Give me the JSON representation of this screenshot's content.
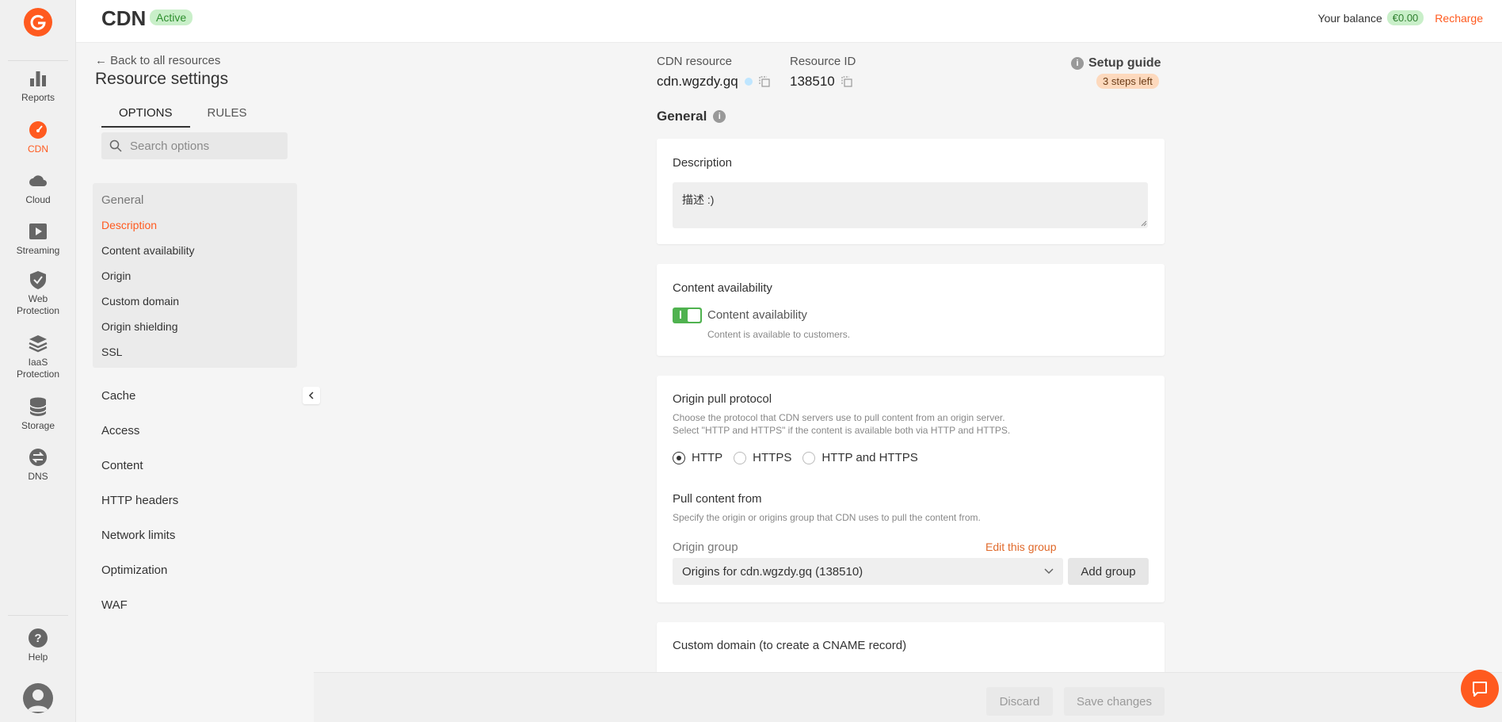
{
  "rail": {
    "items": [
      {
        "label": "Reports",
        "icon": "bar-chart-icon"
      },
      {
        "label": "CDN",
        "icon": "speedometer-icon"
      },
      {
        "label": "Cloud",
        "icon": "cloud-icon"
      },
      {
        "label": "Streaming",
        "icon": "play-icon"
      },
      {
        "label": "Web Protection",
        "icon": "shield-icon"
      },
      {
        "label": "IaaS Protection",
        "icon": "stack-icon"
      },
      {
        "label": "Storage",
        "icon": "database-icon"
      },
      {
        "label": "DNS",
        "icon": "dns-icon"
      }
    ],
    "help_label": "Help"
  },
  "header": {
    "title": "CDN",
    "status": "Active",
    "balance_label": "Your balance",
    "balance_amount": "€0.00",
    "recharge": "Recharge"
  },
  "settings": {
    "back": "← Back to all resources",
    "title": "Resource settings",
    "tabs": [
      "OPTIONS",
      "RULES"
    ],
    "search_placeholder": "Search options",
    "group_title": "General",
    "group_items": [
      "Description",
      "Content availability",
      "Origin",
      "Custom domain",
      "Origin shielding",
      "SSL"
    ],
    "sections": [
      "Cache",
      "Access",
      "Content",
      "HTTP headers",
      "Network limits",
      "Optimization",
      "WAF"
    ]
  },
  "resource": {
    "cdn_label": "CDN resource",
    "cdn_value": "cdn.wgzdy.gq",
    "id_label": "Resource ID",
    "id_value": "138510",
    "setup_guide": "Setup guide",
    "steps_left": "3 steps left"
  },
  "main": {
    "section_title": "General",
    "description": {
      "title": "Description",
      "value": "描述 :)"
    },
    "availability": {
      "title": "Content availability",
      "toggle_label": "Content availability",
      "toggle_on": true,
      "hint": "Content is available to customers."
    },
    "origin": {
      "title": "Origin pull protocol",
      "hint1": "Choose the protocol that CDN servers use to pull content from an origin server.",
      "hint2": "Select \"HTTP and HTTPS\" if the content is available both via HTTP and HTTPS.",
      "options": [
        "HTTP",
        "HTTPS",
        "HTTP and HTTPS"
      ],
      "selected": "HTTP",
      "pull_title": "Pull content from",
      "pull_hint": "Specify the origin or origins group that CDN uses to pull the content from.",
      "group_label": "Origin group",
      "edit_link": "Edit this group",
      "group_value": "Origins for cdn.wgzdy.gq (138510)",
      "add_group": "Add group"
    },
    "custom_domain": {
      "title": "Custom domain (to create a CNAME record)"
    }
  },
  "footer": {
    "discard": "Discard",
    "save": "Save changes"
  },
  "colors": {
    "brand": "#ff5a1f",
    "active_badge": "#c9efc9",
    "toggle_on": "#4fb24f",
    "steps_badge": "#fdd9bd"
  }
}
